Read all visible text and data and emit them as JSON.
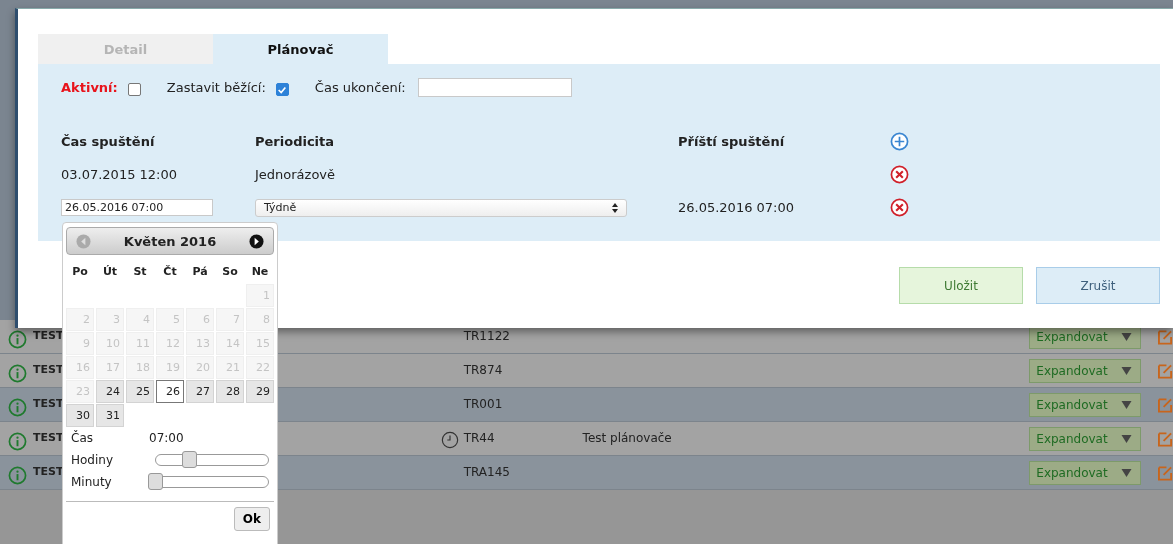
{
  "background_rows": [
    {
      "name": "TEST",
      "code": "TR1122",
      "note_icon": false,
      "action": "Expandovat",
      "color": "#a3a3a3"
    },
    {
      "name": "TEST",
      "code": "TR874",
      "note_icon": false,
      "action": "Expandovat",
      "color": "#a3a3a3"
    },
    {
      "name": "TEST",
      "code": "TR001",
      "note_icon": false,
      "action": "Expandovat",
      "color": "#8a939c"
    },
    {
      "name": "TEST",
      "code": "TR44",
      "note_icon": true,
      "description": "Test plánovače",
      "action": "Expandovat",
      "color": "#a3a3a3"
    },
    {
      "name": "TEST",
      "code": "TRA145",
      "note_icon": false,
      "action": "Expandovat",
      "color": "#8a939c"
    }
  ],
  "tabs": [
    {
      "label": "Detail",
      "selected": false
    },
    {
      "label": "Plánovač",
      "selected": true
    }
  ],
  "options": {
    "active_label": "Aktivní:",
    "active_checked": false,
    "stop_label": "Zastavit běžící:",
    "stop_checked": true,
    "end_label": "Čas ukončení:"
  },
  "schedule": {
    "columns": [
      "Čas spuštění",
      "Periodicita",
      "Příští spuštění"
    ],
    "rows": [
      {
        "kind": "text",
        "start": "03.07.2015 12:00",
        "period": "Jednorázově"
      },
      {
        "kind": "edit",
        "start": "26.05.2016 07:00",
        "period": "Týdně",
        "next": "26.05.2016 07:00"
      }
    ]
  },
  "buttons": [
    {
      "label": "Uložit",
      "kind": "save"
    },
    {
      "label": "Zrušit",
      "kind": "cancel"
    }
  ],
  "datepicker": {
    "month": "Květen 2016",
    "weekdays": [
      "Po",
      "Út",
      "St",
      "Čt",
      "Pá",
      "So",
      "Ne"
    ],
    "days": [
      {
        "label": "1",
        "disabled": true,
        "selected": false
      },
      {
        "label": "2",
        "disabled": true,
        "selected": false
      },
      {
        "label": "3",
        "disabled": true,
        "selected": false
      },
      {
        "label": "4",
        "disabled": true,
        "selected": false
      },
      {
        "label": "5",
        "disabled": true,
        "selected": false
      },
      {
        "label": "6",
        "disabled": true,
        "selected": false
      },
      {
        "label": "7",
        "disabled": true,
        "selected": false
      },
      {
        "label": "8",
        "disabled": true,
        "selected": false
      },
      {
        "label": "9",
        "disabled": true,
        "selected": false
      },
      {
        "label": "10",
        "disabled": true,
        "selected": false
      },
      {
        "label": "11",
        "disabled": true,
        "selected": false
      },
      {
        "label": "12",
        "disabled": true,
        "selected": false
      },
      {
        "label": "13",
        "disabled": true,
        "selected": false
      },
      {
        "label": "14",
        "disabled": true,
        "selected": false
      },
      {
        "label": "15",
        "disabled": true,
        "selected": false
      },
      {
        "label": "16",
        "disabled": true,
        "selected": false
      },
      {
        "label": "17",
        "disabled": true,
        "selected": false
      },
      {
        "label": "18",
        "disabled": true,
        "selected": false
      },
      {
        "label": "19",
        "disabled": true,
        "selected": false
      },
      {
        "label": "20",
        "disabled": true,
        "selected": false
      },
      {
        "label": "21",
        "disabled": true,
        "selected": false
      },
      {
        "label": "22",
        "disabled": true,
        "selected": false
      },
      {
        "label": "23",
        "disabled": true,
        "selected": false
      },
      {
        "label": "24",
        "disabled": false,
        "selected": false
      },
      {
        "label": "25",
        "disabled": false,
        "selected": false
      },
      {
        "label": "26",
        "disabled": false,
        "selected": true
      },
      {
        "label": "27",
        "disabled": false,
        "selected": false
      },
      {
        "label": "28",
        "disabled": false,
        "selected": false
      },
      {
        "label": "29",
        "disabled": false,
        "selected": false
      },
      {
        "label": "30",
        "disabled": false,
        "selected": false
      },
      {
        "label": "31",
        "disabled": false,
        "selected": false
      }
    ],
    "time_label": "Čas",
    "time": "07:00",
    "sliders": [
      {
        "label": "Hodiny",
        "level": 0.3
      },
      {
        "label": "Minuty",
        "level": 0
      }
    ],
    "ok": "Ok"
  }
}
